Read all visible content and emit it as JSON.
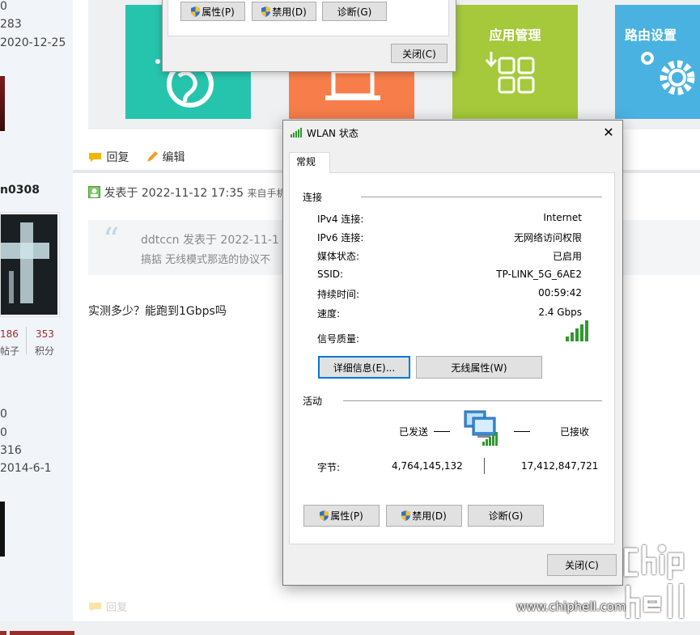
{
  "left_panel": {
    "lines_top": [
      "0",
      "283",
      "2020-12-25"
    ],
    "username": "n0308",
    "stats": {
      "posts_value": "186",
      "posts_label": "帖子",
      "points_value": "353",
      "points_label": "积分"
    },
    "lines_bottom": [
      "0",
      "0",
      "316",
      "2014-6-1"
    ]
  },
  "banner": {
    "tiles": [
      {
        "title": "",
        "color": "#27c4ad"
      },
      {
        "title": "",
        "color": "#f77e4a"
      },
      {
        "title": "应用管理",
        "color": "#a5c93a"
      },
      {
        "title": "路由设置",
        "color": "#4ab2e0"
      }
    ]
  },
  "post_actions": {
    "reply": "回复",
    "edit": "编辑"
  },
  "post": {
    "meta": "发表于 2022-11-12 17:35",
    "meta_source": "来自手机",
    "quote_line1": "ddtccn 发表于 2022-11-1",
    "quote_line2": "搞掂 无线模式那选的协议不",
    "reply_text": "实测多少？能跑到1Gbps吗",
    "footer_reply": "回复"
  },
  "old_dialog": {
    "properties": "属性(P)",
    "disable": "禁用(D)",
    "diagnose": "诊断(G)",
    "close": "关闭(C)"
  },
  "wlan": {
    "title": "WLAN 状态",
    "close_x": "✕",
    "tab": "常规",
    "connection_header": "连接",
    "rows": [
      {
        "label": "IPv4 连接:",
        "value": "Internet"
      },
      {
        "label": "IPv6 连接:",
        "value": "无网络访问权限"
      },
      {
        "label": "媒体状态:",
        "value": "已启用"
      },
      {
        "label": "SSID:",
        "value": "TP-LINK_5G_6AE2"
      },
      {
        "label": "持续时间:",
        "value": "00:59:42"
      },
      {
        "label": "速度:",
        "value": "2.4 Gbps"
      }
    ],
    "signal_label": "信号质量:",
    "signal_bars": 5,
    "details_button": "详细信息(E)...",
    "wireless_props_button": "无线属性(W)",
    "activity_header": "活动",
    "sent_label": "已发送",
    "received_label": "已接收",
    "bytes_label": "字节:",
    "bytes_sent": "4,764,145,132",
    "bytes_received": "17,412,847,721",
    "properties_button": "属性(P)",
    "disable_button": "禁用(D)",
    "diagnose_button": "诊断(G)",
    "close_button": "关闭(C)"
  },
  "watermark": {
    "site": "www.chiphell.com",
    "logo": "chip hell"
  },
  "colors": {
    "focus_blue": "#0078d7",
    "signal_green": "#2e9a2e",
    "stat_red": "#9b2c2c"
  }
}
